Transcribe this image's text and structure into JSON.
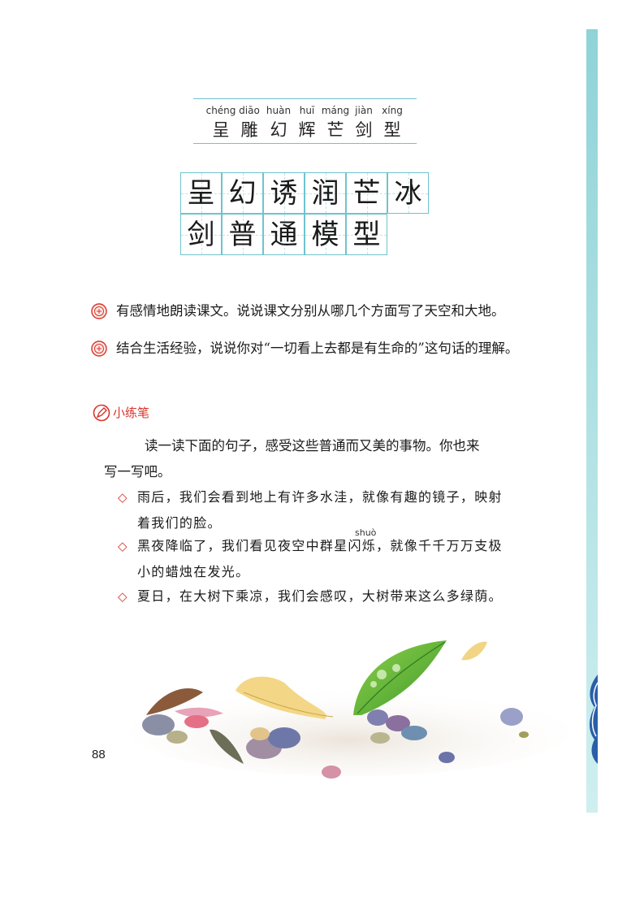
{
  "reading": [
    {
      "pinyin": "chéng",
      "hanzi": "呈"
    },
    {
      "pinyin": "diāo",
      "hanzi": "雕"
    },
    {
      "pinyin": "huàn",
      "hanzi": "幻"
    },
    {
      "pinyin": "huī",
      "hanzi": "辉"
    },
    {
      "pinyin": "máng",
      "hanzi": "芒"
    },
    {
      "pinyin": "jiàn",
      "hanzi": "剑"
    },
    {
      "pinyin": "xíng",
      "hanzi": "型"
    }
  ],
  "writing": {
    "row1": [
      "呈",
      "幻",
      "诱",
      "润",
      "芒",
      "冰"
    ],
    "row2": [
      "剑",
      "普",
      "通",
      "模",
      "型"
    ]
  },
  "questions": [
    "有感情地朗读课文。说说课文分别从哪几个方面写了天空和大地。",
    "结合生活经验，说说你对“一切看上去都是有生命的”这句话的理解。"
  ],
  "practice": {
    "title": "小练笔",
    "intro_line1": "读一读下面的句子，感受这些普通而又美的事物。你也来",
    "intro_line2": "写一写吧。",
    "bullet": "◇",
    "items": [
      {
        "line1": "雨后，我们会看到地上有许多水洼，就像有趣的镜子，映射",
        "line2": "着我们的脸。"
      },
      {
        "line1": "黑夜降临了，我们看见夜空中群星闪烁，就像千千万万支极",
        "line2": "小的蜡烛在发光。",
        "annotation": "shuò"
      },
      {
        "line1": "夏日，在大树下乘凉，我们会感叹，大树带来这么多绿荫。",
        "line2": ""
      }
    ]
  },
  "page_number": "88",
  "colors": {
    "accent": "#d9342b",
    "grid": "#6fc3cd",
    "side_strip": "#8fd3d8"
  },
  "icons": [
    "question-seal-icon",
    "pen-icon",
    "diamond-bullet-icon"
  ]
}
